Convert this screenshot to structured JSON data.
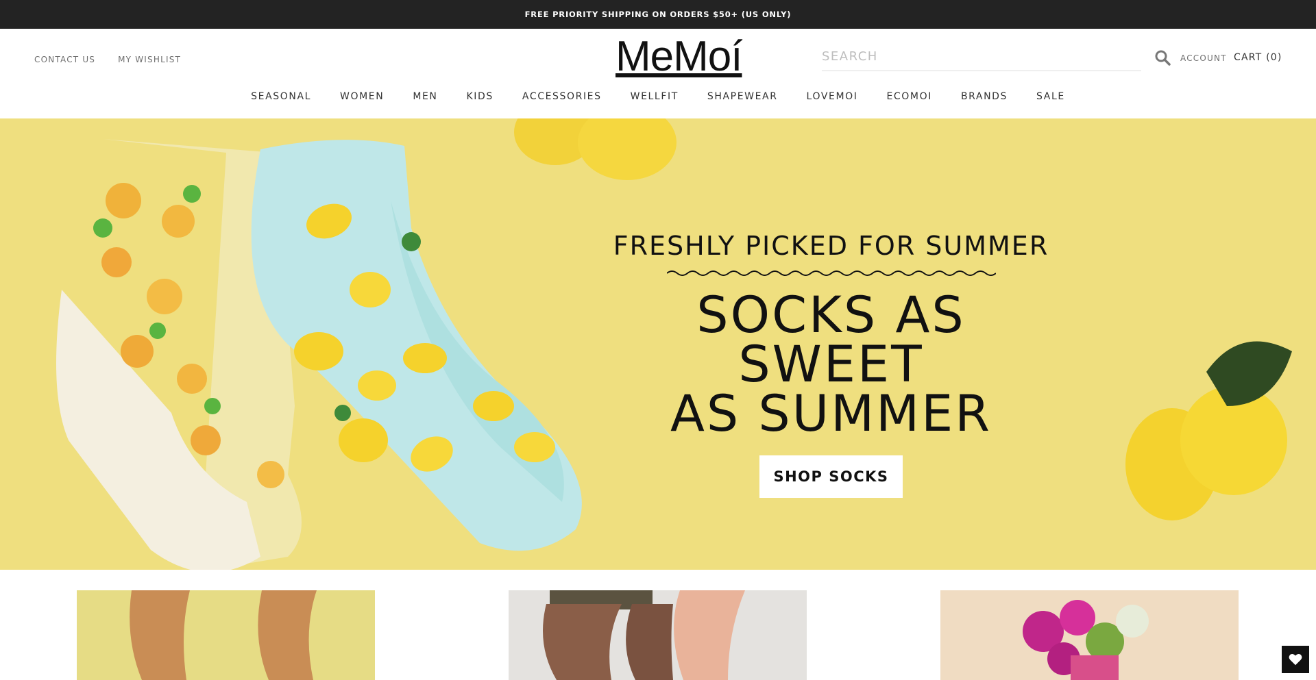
{
  "announcement": {
    "text": "FREE PRIORITY SHIPPING ON ORDERS $50+ (US ONLY)"
  },
  "header": {
    "left_links": [
      "CONTACT US",
      "MY WISHLIST"
    ],
    "logo_text": "MeMoí",
    "search": {
      "placeholder": "SEARCH",
      "value": ""
    },
    "account_label": "ACCOUNT",
    "cart_label": "CART (0)"
  },
  "nav": {
    "items": [
      "SEASONAL",
      "WOMEN",
      "MEN",
      "KIDS",
      "ACCESSORIES",
      "WELLFIT",
      "SHAPEWEAR",
      "LOVEMOI",
      "ECOMOI",
      "BRANDS",
      "SALE"
    ]
  },
  "hero": {
    "kicker": "FRESHLY PICKED FOR SUMMER",
    "title_line1": "SOCKS AS SWEET",
    "title_line2": "AS SUMMER",
    "button_label": "SHOP SOCKS"
  },
  "colors": {
    "announcement_bg": "#232323",
    "hero_bg": "#efdf7f",
    "text": "#111111",
    "muted": "#6f6f6f"
  },
  "icons": [
    "search-icon",
    "heart-icon"
  ]
}
